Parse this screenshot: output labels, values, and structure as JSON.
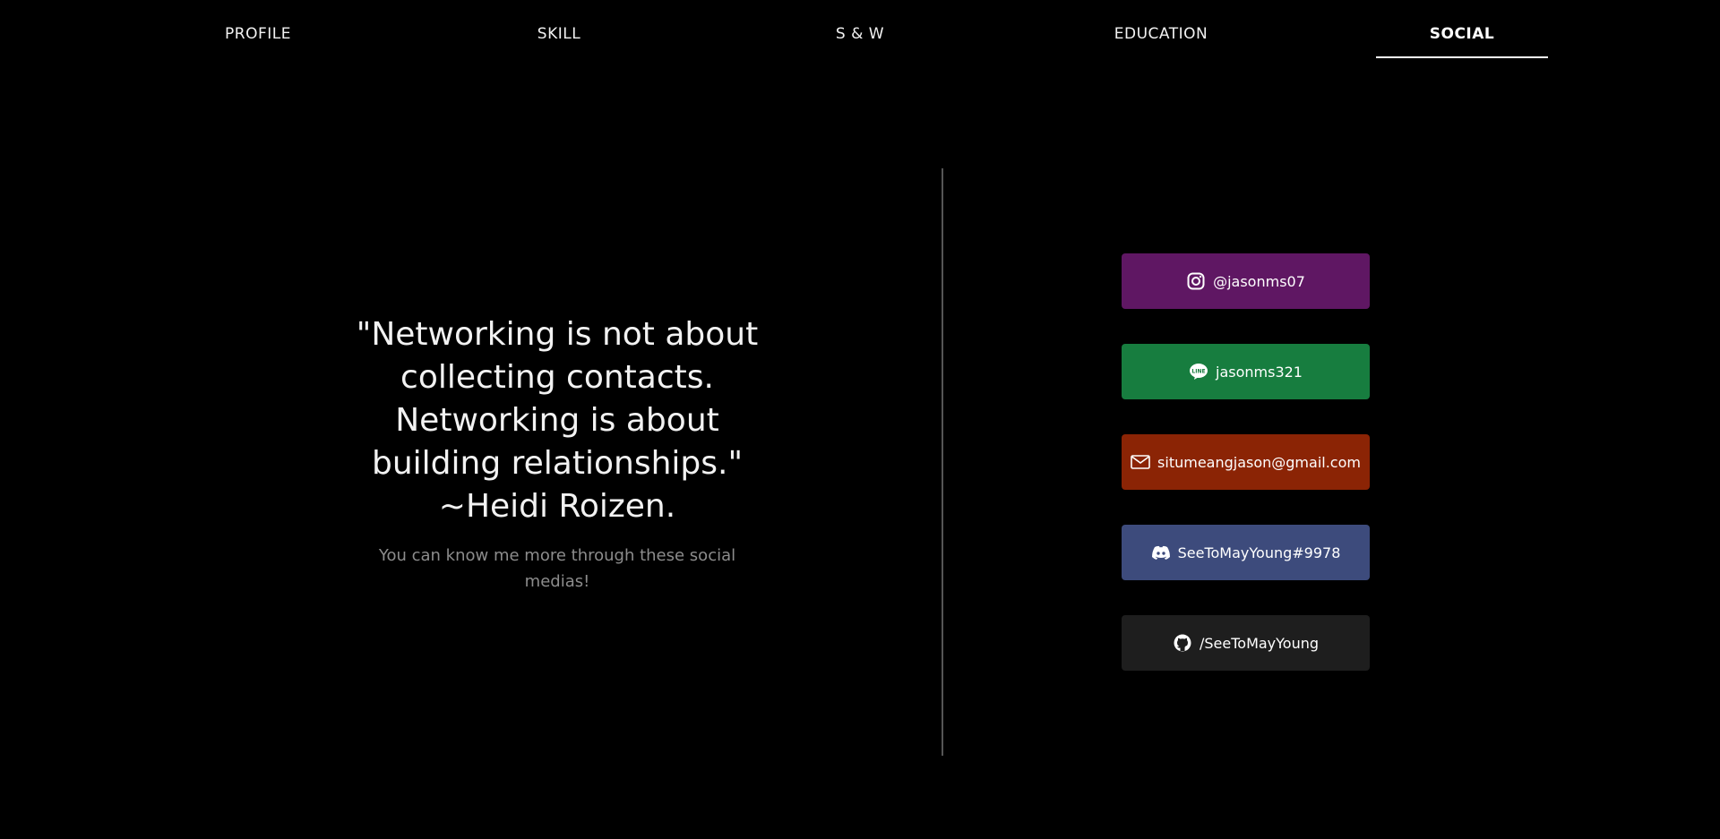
{
  "nav": {
    "items": [
      {
        "label": "PROFILE"
      },
      {
        "label": "SKILL"
      },
      {
        "label": "S & W"
      },
      {
        "label": "EDUCATION"
      },
      {
        "label": "SOCIAL"
      }
    ],
    "active": "SOCIAL"
  },
  "main": {
    "quote": "\"Networking is not about collecting contacts. Networking is about building relationships.\" ~Heidi Roizen.",
    "subtext": "You can know me more through these social medias!"
  },
  "social": {
    "items": [
      {
        "label": "@jasonms07",
        "icon": "instagram-icon",
        "color": "#5f1763"
      },
      {
        "label": "jasonms321",
        "icon": "line-icon",
        "color": "#177d3f"
      },
      {
        "label": "situmeangjason@gmail.com",
        "icon": "mail-icon",
        "color": "#8b2405"
      },
      {
        "label": "SeeToMayYoung#9978",
        "icon": "discord-icon",
        "color": "#3d4b7c"
      },
      {
        "label": "/SeeToMayYoung",
        "icon": "github-icon",
        "color": "#1e1e1e"
      }
    ]
  }
}
